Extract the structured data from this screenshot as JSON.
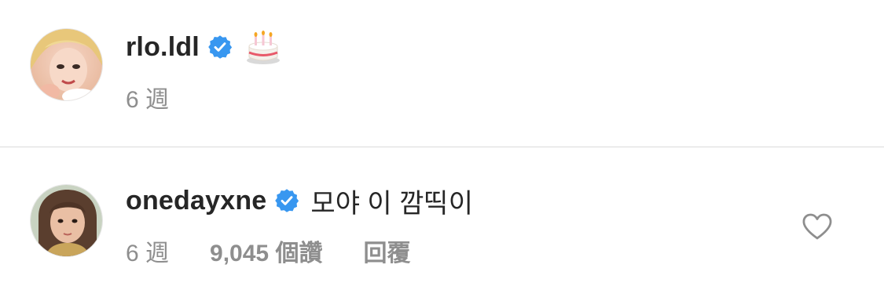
{
  "comments": [
    {
      "username": "rlo.ldl",
      "verified": true,
      "text": "",
      "emoji": "🎂",
      "time": "6 週"
    },
    {
      "username": "onedayxne",
      "verified": true,
      "text": "모야 이 깜띡이",
      "time": "6 週",
      "likes": "9,045 個讚",
      "reply_label": "回覆"
    }
  ],
  "colors": {
    "verified_blue": "#3897f0",
    "secondary_text": "#8e8e8e",
    "primary_text": "#262626",
    "divider": "#dbdbdb"
  },
  "icons": {
    "verified": "verified-badge-icon",
    "like": "heart-outline-icon",
    "emoji": "birthday-cake-icon"
  }
}
